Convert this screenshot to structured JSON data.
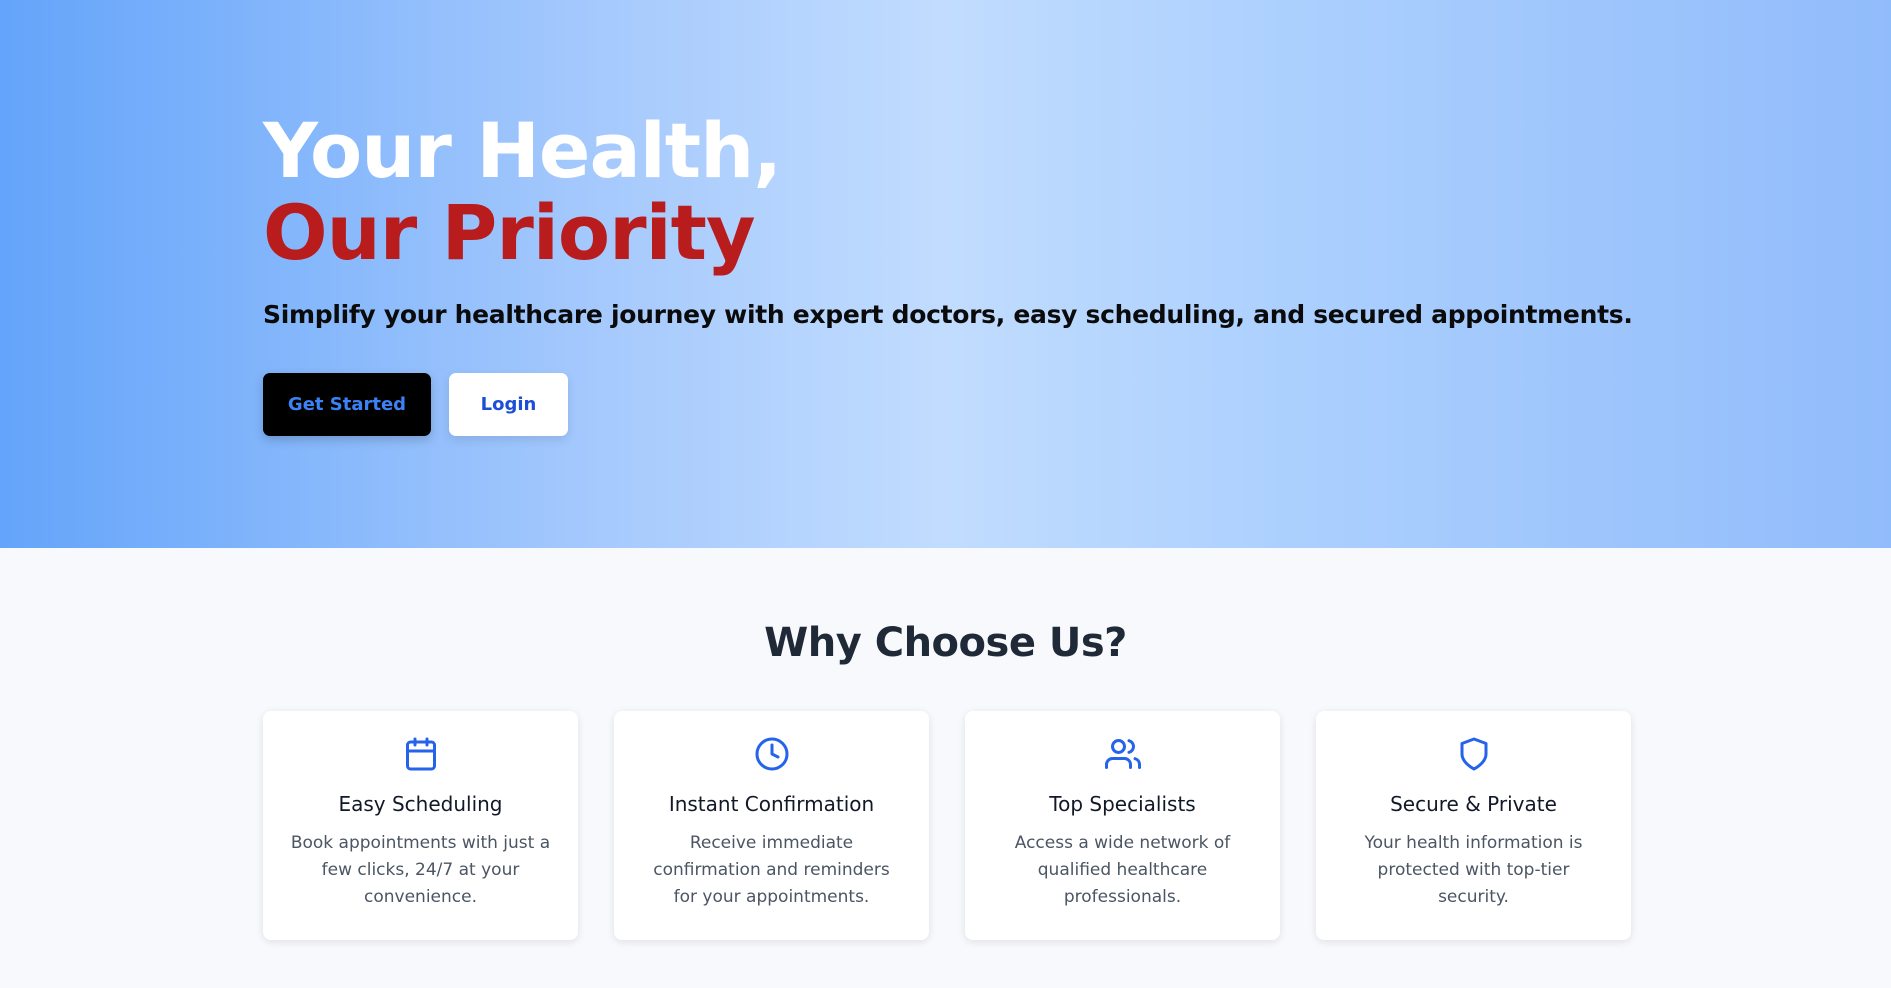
{
  "hero": {
    "title_line1": "Your Health,",
    "title_line2": "Our Priority",
    "subtitle": "Simplify your healthcare journey with expert doctors, easy scheduling, and secured appointments.",
    "primary_button": "Get Started",
    "secondary_button": "Login"
  },
  "features": {
    "heading": "Why Choose Us?",
    "cards": [
      {
        "icon": "calendar-icon",
        "title": "Easy Scheduling",
        "text": "Book appointments with just a few clicks, 24/7 at your convenience."
      },
      {
        "icon": "clock-icon",
        "title": "Instant Confirmation",
        "text": "Receive immediate confirmation and reminders for your appointments."
      },
      {
        "icon": "users-icon",
        "title": "Top Specialists",
        "text": "Access a wide network of qualified healthcare professionals."
      },
      {
        "icon": "shield-icon",
        "title": "Secure & Private",
        "text": "Your health information is protected with top-tier security."
      }
    ]
  },
  "colors": {
    "accent_red": "#b91c1c",
    "accent_blue": "#2563eb",
    "button_dark": "#000000"
  }
}
